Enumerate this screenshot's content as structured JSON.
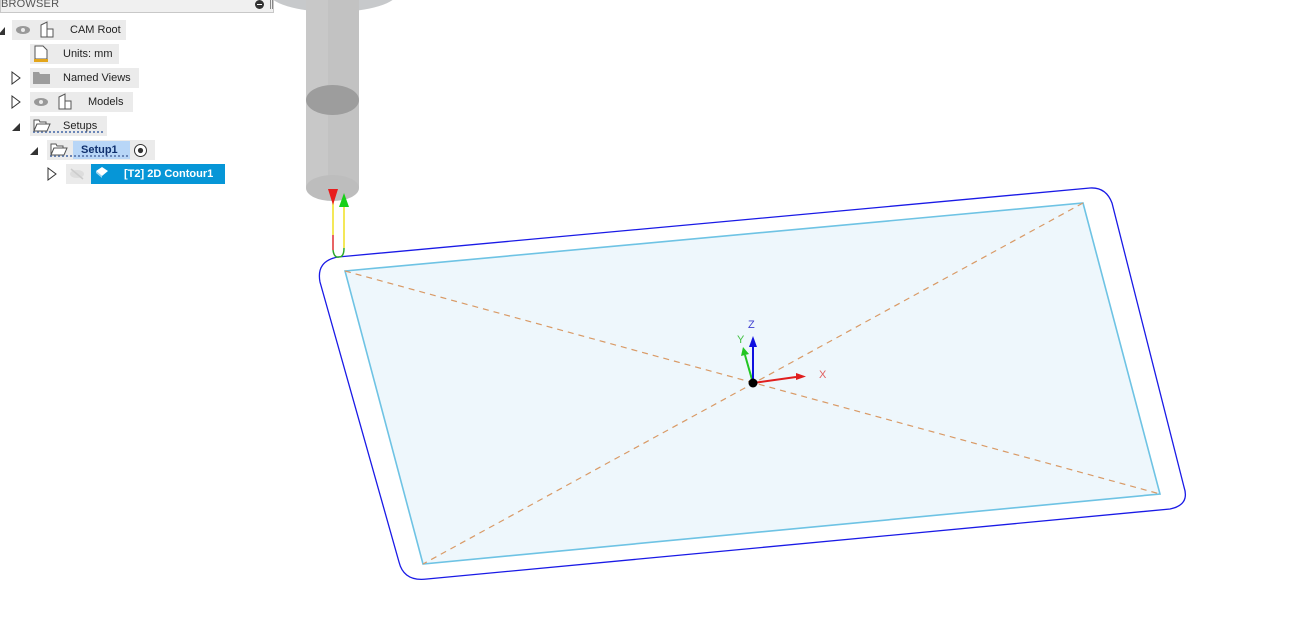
{
  "browser": {
    "title": "BROWSER",
    "collapse_icon": "minus-circle-icon",
    "tree": [
      {
        "label": "CAM Root",
        "expanded": true,
        "icons": [
          "eye-icon",
          "component-icon"
        ]
      },
      {
        "label": "Units: mm",
        "icons": [
          "document-units-icon"
        ]
      },
      {
        "label": "Named Views",
        "expanded": false,
        "icons": [
          "folder-icon"
        ]
      },
      {
        "label": "Models",
        "expanded": false,
        "icons": [
          "eye-icon",
          "component-icon"
        ]
      },
      {
        "label": "Setups",
        "expanded": true,
        "icons": [
          "open-folder-icon"
        ]
      },
      {
        "label": "Setup1",
        "expanded": true,
        "active": true,
        "icons": [
          "open-folder-icon",
          "activate-radio-icon"
        ]
      },
      {
        "label": "[T2] 2D Contour1",
        "expanded": false,
        "selected": true,
        "icons": [
          "eye-hidden-icon",
          "operation-icon"
        ]
      }
    ]
  },
  "viewport": {
    "triad": {
      "x_label": "X",
      "y_label": "Y",
      "z_label": "Z"
    },
    "colors": {
      "stock_outline": "#1a1ae6",
      "part_edge": "#6ec3e4",
      "part_fill": "#eef7fc",
      "diagonal": "#d99a66",
      "tool": "#c4c4c4",
      "selection": "#0696d7"
    }
  }
}
